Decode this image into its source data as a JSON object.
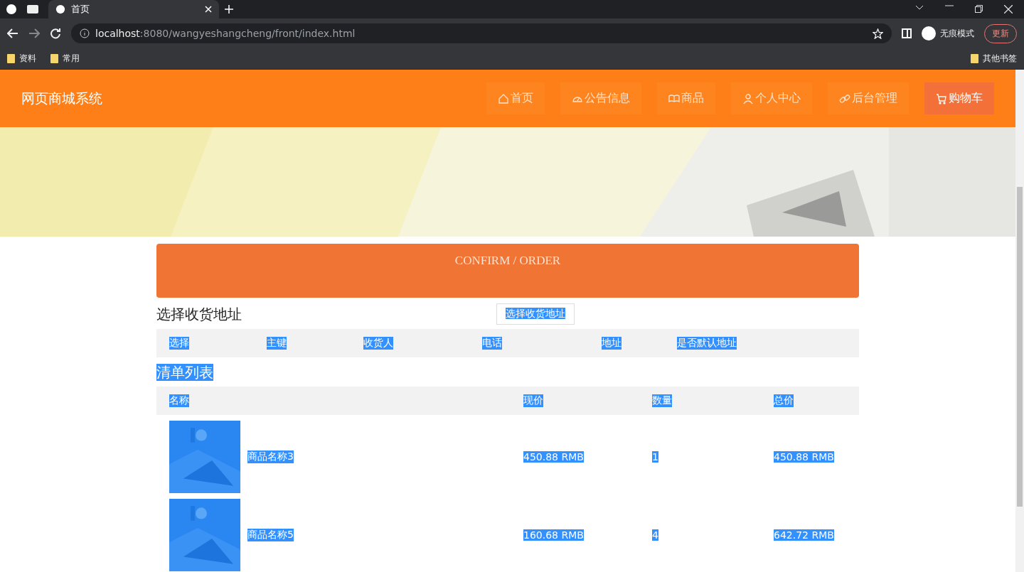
{
  "browser": {
    "tabs": [
      {
        "title": "首页",
        "selected": true
      }
    ],
    "url_host": "localhost",
    "url_rest": ":8080/wangyeshangcheng/front/index.html",
    "profile": "无痕模式",
    "update_button": "更新",
    "bookmarks": [
      "资料",
      "常用"
    ],
    "other_bookmarks": "其他书签"
  },
  "nav": {
    "brand": "网页商城系统",
    "items": [
      {
        "label": "首页",
        "selected": false
      },
      {
        "label": "公告信息",
        "selected": false
      },
      {
        "label": "商品",
        "selected": false
      },
      {
        "label": "个人中心",
        "selected": false
      },
      {
        "label": "后台管理",
        "selected": false
      },
      {
        "label": "购物车",
        "selected": true
      }
    ]
  },
  "confirm_header": {
    "title": "CONFIRM / ORDER"
  },
  "address_section": {
    "title": "选择收货地址",
    "button": "选择收货地址",
    "columns": [
      "选择",
      "主键",
      "收货人",
      "电话",
      "地址",
      "是否默认地址"
    ]
  },
  "order_section": {
    "title": "清单列表",
    "columns": [
      "名称",
      "现价",
      "数量",
      "总价"
    ],
    "rows": [
      {
        "name": "商品名称3",
        "price": "450.88 RMB",
        "quantity": "1",
        "total": "450.88 RMB"
      },
      {
        "name": "商品名称5",
        "price": "160.68 RMB",
        "quantity": "4",
        "total": "642.72 RMB"
      }
    ]
  }
}
